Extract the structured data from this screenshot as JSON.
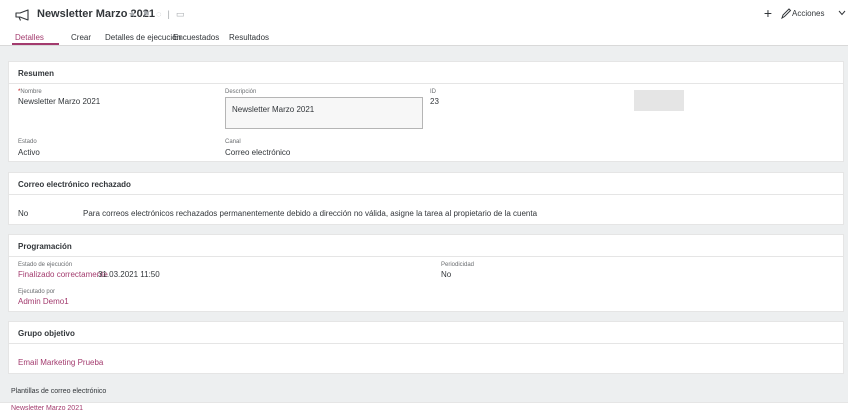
{
  "header": {
    "title": "Newsletter Marzo 2021",
    "star_glyph": "★",
    "flag_glyph": "⚑",
    "rss_glyph": "◌",
    "sep_glyph": "|",
    "comment_glyph": "▭",
    "plus_glyph": "+",
    "actions_label": "Acciones"
  },
  "tabs": [
    {
      "label": "Detalles",
      "active": true
    },
    {
      "label": "Crear",
      "active": false
    },
    {
      "label": "Detalles de ejecución",
      "active": false
    },
    {
      "label": "Encuestados",
      "active": false
    },
    {
      "label": "Resultados",
      "active": false
    }
  ],
  "resumen": {
    "title": "Resumen",
    "nombre_required": "*",
    "nombre_label": "Nombre",
    "nombre_value": "Newsletter Marzo 2021",
    "descripcion_label": "Descripción",
    "descripcion_value": "Newsletter Marzo 2021",
    "id_label": "ID",
    "id_value": "23",
    "estado_label": "Estado",
    "estado_value": "Activo",
    "canal_label": "Canal",
    "canal_value": "Correo electrónico"
  },
  "rechazado": {
    "title": "Correo electrónico rechazado",
    "value": "No",
    "note": "Para correos electrónicos rechazados permanentemente debido a dirección no válida, asigne la tarea al propietario de la cuenta"
  },
  "programacion": {
    "title": "Programación",
    "estado_label": "Estado de ejecución",
    "estado_link": "Finalizado correctamente",
    "estado_time": "31.03.2021 11:50",
    "periodicidad_label": "Periodicidad",
    "periodicidad_value": "No",
    "ejecutado_label": "Ejecutado por",
    "ejecutado_link": "Admin Demo1"
  },
  "grupo": {
    "title": "Grupo objetivo",
    "link": "Email Marketing Prueba"
  },
  "plantillas": {
    "label": "Plantillas de correo electrónico",
    "link": "Newsletter Marzo 2021"
  },
  "colors": {
    "accent": "#a33b6e",
    "background": "#edeff0",
    "text": "#32363a"
  },
  "icons": [
    "megaphone-icon",
    "star-icon",
    "flag-icon",
    "rss-icon",
    "comment-icon",
    "plus-icon",
    "pencil-icon",
    "chevron-down-icon"
  ]
}
